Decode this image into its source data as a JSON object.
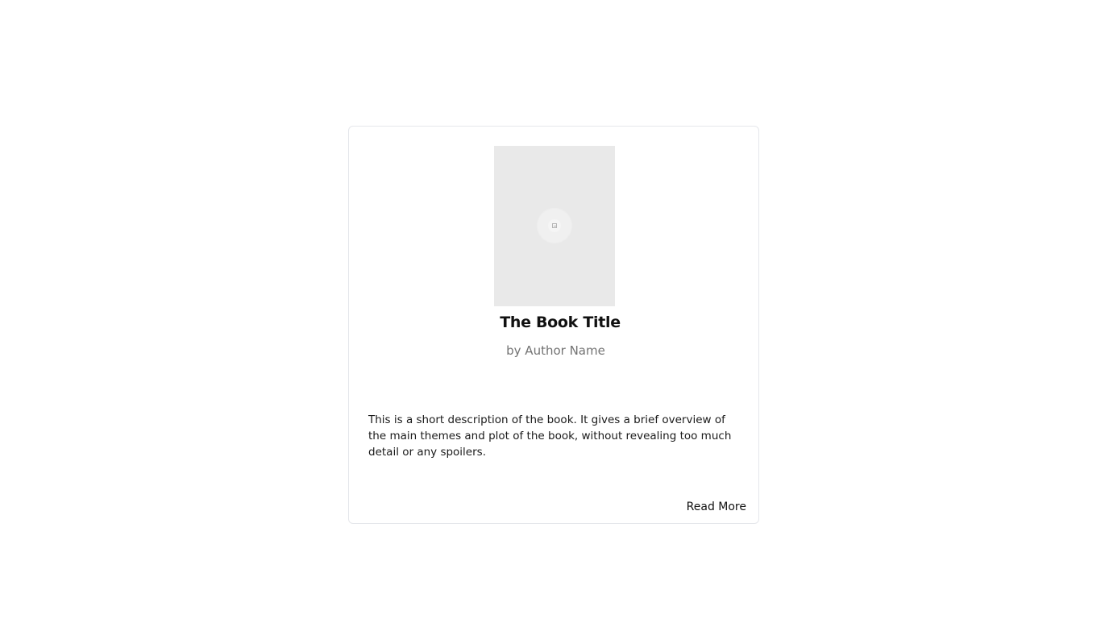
{
  "book": {
    "title": "The Book Title",
    "author": "by Author Name",
    "description": "This is a short description of the book. It gives a brief overview of the main themes and plot of the book, without revealing too much detail or any spoilers.",
    "read_more_label": "Read More",
    "cover_icon": "image-placeholder-icon"
  },
  "colors": {
    "cover_background": "#e9e9e9",
    "author_text": "#737373",
    "card_border": "#e5e7eb"
  }
}
